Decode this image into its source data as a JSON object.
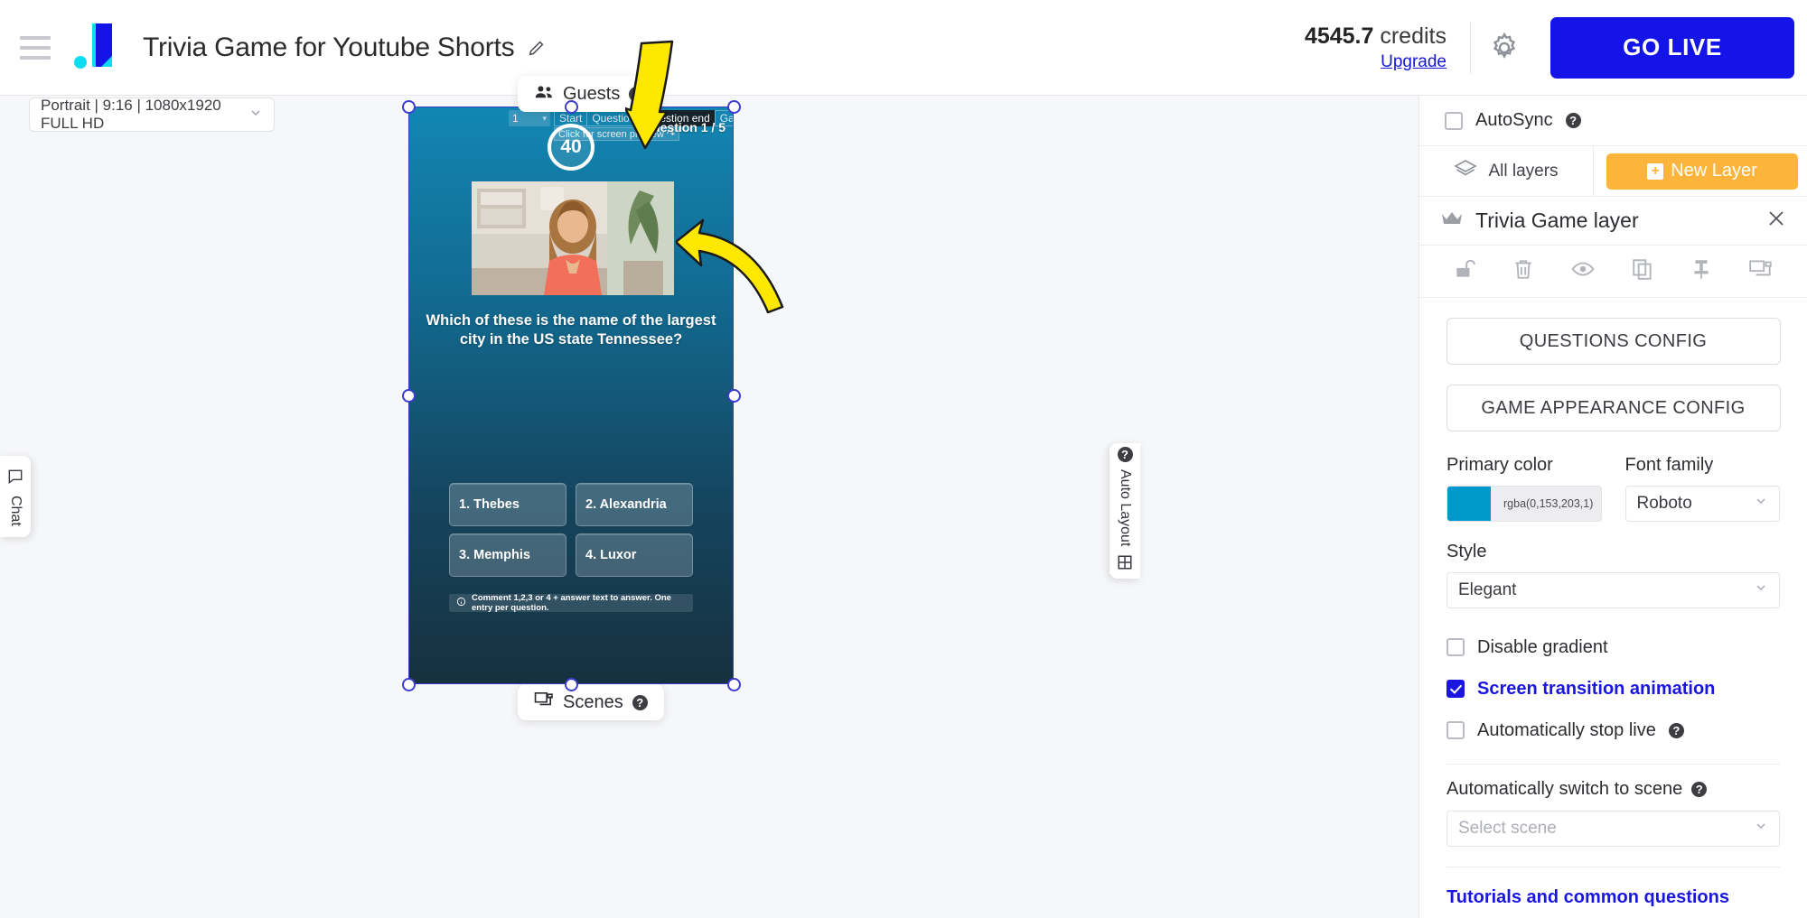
{
  "topbar": {
    "menu_icon": "hamburger-icon",
    "logo_icon": "brand-logo-icon",
    "project_title": "Trivia Game for Youtube Shorts",
    "edit_icon": "pencil-icon",
    "credits_value": "4545.7",
    "credits_word": "credits",
    "upgrade_label": "Upgrade",
    "settings_icon": "gear-icon",
    "go_live_label": "GO LIVE"
  },
  "workarea": {
    "resolution_label": "Portrait | 9:16 | 1080x1920 FULL HD",
    "guests_label": "Guests",
    "scenes_label": "Scenes",
    "chat_label": "Chat",
    "auto_layout_label": "Auto Layout"
  },
  "preview": {
    "question_number": "1",
    "stage_tabs": [
      {
        "label": "Start",
        "active": false
      },
      {
        "label": "Question",
        "active": false
      },
      {
        "label": "Question end",
        "active": true
      },
      {
        "label": "Game end",
        "active": false
      }
    ],
    "screen_preview_hint": "Click for screen preview",
    "question_counter": "Question 1 / 5",
    "timer_value": "40",
    "question_text": "Which of these is the name of the largest city in the US state Tennessee?",
    "answers": [
      "1. Thebes",
      "2. Alexandria",
      "3. Memphis",
      "4. Luxor"
    ],
    "hint_text": "Comment 1,2,3 or 4 + answer text to answer. One entry per question."
  },
  "rightpanel": {
    "autosync_label": "AutoSync",
    "autosync_checked": false,
    "all_layers_label": "All layers",
    "new_layer_label": "New Layer",
    "layer_title": "Trivia Game layer",
    "layer_tools": [
      "unlock-icon",
      "trash-icon",
      "eye-icon",
      "copy-icon",
      "pin-icon",
      "screen-fit-icon"
    ],
    "questions_config_label": "QUESTIONS CONFIG",
    "game_appearance_config_label": "GAME APPEARANCE CONFIG",
    "primary_color_label": "Primary color",
    "primary_color_value": "rgba(0,153,203,1)",
    "primary_color_hex": "#0099cb",
    "font_family_label": "Font family",
    "font_family_value": "Roboto",
    "style_label": "Style",
    "style_value": "Elegant",
    "disable_gradient_label": "Disable gradient",
    "disable_gradient_checked": false,
    "screen_transition_label": "Screen transition animation",
    "screen_transition_checked": true,
    "auto_stop_live_label": "Automatically stop live",
    "auto_stop_live_checked": false,
    "auto_switch_scene_label": "Automatically switch to scene",
    "select_scene_placeholder": "Select scene",
    "tutorials_label": "Tutorials and common questions"
  },
  "annotations": {
    "arrow_down_color": "#ffe800",
    "arrow_curve_color": "#ffe800"
  }
}
